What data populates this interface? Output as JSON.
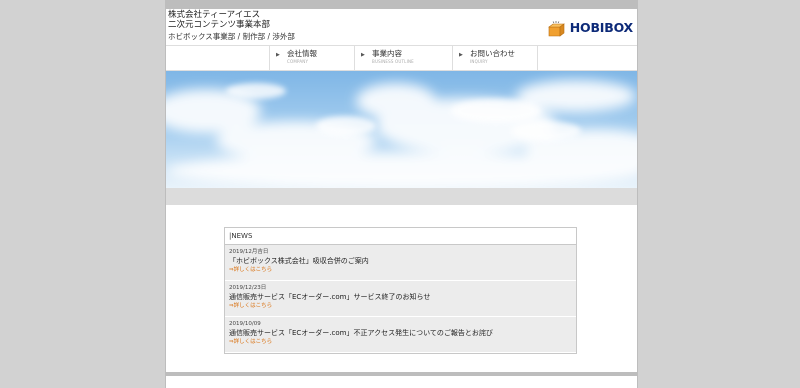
{
  "header": {
    "company_line1": "株式会社ティーアイエス",
    "company_line2": "二次元コンテンツ事業本部",
    "department": "ホビボックス事業部 / 制作部 / 渉外部",
    "logo_text": "HOBIBOX"
  },
  "nav": [
    {
      "label": "会社情報",
      "sub": "COMPANY"
    },
    {
      "label": "事業内容",
      "sub": "BUSINESS OUTLINE"
    },
    {
      "label": "お問い合わせ",
      "sub": "INQUIRY"
    }
  ],
  "news": {
    "heading": "NEWS",
    "items": [
      {
        "date": "2019/12月吉日",
        "title": "「ホビボックス株式会社」吸収合併のご案内",
        "link": "⇒詳しくはこちら"
      },
      {
        "date": "2019/12/23日",
        "title": "通信販売サービス「ECオーダー.com」サービス終了のお知らせ",
        "link": "⇒詳しくはこちら"
      },
      {
        "date": "2019/10/09",
        "title": "通信販売サービス「ECオーダー.com」不正アクセス発生についてのご報告とお詫び",
        "link": "⇒詳しくはこちら"
      }
    ]
  },
  "colors": {
    "logo": "#0d2a78",
    "logo_box": "#f0a030",
    "link": "#d9700f",
    "background": "#d2d2d2"
  }
}
